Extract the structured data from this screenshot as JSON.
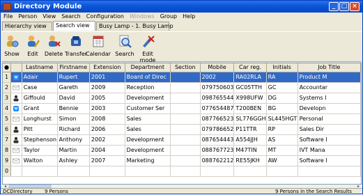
{
  "window": {
    "title": "Directory Module"
  },
  "menu": [
    {
      "label": "File",
      "disabled": false
    },
    {
      "label": "Person",
      "disabled": false
    },
    {
      "label": "View",
      "disabled": false
    },
    {
      "label": "Search",
      "disabled": false
    },
    {
      "label": "Configuration",
      "disabled": false
    },
    {
      "label": "Windows",
      "disabled": true
    },
    {
      "label": "Group",
      "disabled": false
    },
    {
      "label": "Help",
      "disabled": false
    }
  ],
  "tabs": [
    "Hierarchy view",
    "Search view",
    "Busy Lamp - 1. Busy Lamp"
  ],
  "toolbar": {
    "show": "Show",
    "edit": "Edit",
    "delete": "Delete",
    "transfer": "Transfer",
    "calendar": "Calendar",
    "search": "Search",
    "edit_mode": "Edit mode"
  },
  "columns": [
    "Lastname",
    "Firstname",
    "Extension",
    "Department",
    "Section",
    "Mobile",
    "Car reg.",
    "Initials",
    "Job Title"
  ],
  "rows": [
    {
      "n": "1",
      "icon": "phone-person-icon",
      "lastname": "Adair",
      "firstname": "Rupert",
      "extension": "2001",
      "department": "Board of Direc",
      "section": "",
      "mobile": "2002",
      "carreg": "RA02RLA",
      "initials": "RA",
      "jobtitle": "Product M"
    },
    {
      "n": "2",
      "icon": "envelope-icon",
      "lastname": "Case",
      "firstname": "Gareth",
      "extension": "2009",
      "department": "Reception",
      "section": "",
      "mobile": "079750603",
      "carreg": "GC05TTH",
      "initials": "GC",
      "jobtitle": "Accountar"
    },
    {
      "n": "3",
      "icon": "person-busy-icon",
      "lastname": "Giffould",
      "firstname": "David",
      "extension": "2005",
      "department": "Development",
      "section": "",
      "mobile": "098765544",
      "carreg": "X998UFW",
      "initials": "DG",
      "jobtitle": "Systems I"
    },
    {
      "n": "4",
      "icon": "phone-person-icon",
      "lastname": "Grant",
      "firstname": "Bennie",
      "extension": "2003",
      "department": "Customer Ser",
      "section": "",
      "mobile": "077654487",
      "carreg": "T200BEN",
      "initials": "BG",
      "jobtitle": "Developn"
    },
    {
      "n": "5",
      "icon": "envelope-icon",
      "lastname": "Longhurst",
      "firstname": "Simon",
      "extension": "2008",
      "department": "Sales",
      "section": "",
      "mobile": "087766523",
      "carreg": "SL776GGH",
      "initials": "SL445HGT",
      "jobtitle": "Personal"
    },
    {
      "n": "6",
      "icon": "person-busy-icon",
      "lastname": "Pitt",
      "firstname": "Richard",
      "extension": "2006",
      "department": "Sales",
      "section": "",
      "mobile": "079786652",
      "carreg": "P11TTR",
      "initials": "RP",
      "jobtitle": "Sales Dir"
    },
    {
      "n": "7",
      "icon": "person-busy-icon",
      "lastname": "Stephenson",
      "firstname": "Anthony",
      "extension": "2002",
      "department": "Development",
      "section": "",
      "mobile": "087654443",
      "carreg": "A554JJH",
      "initials": "AS",
      "jobtitle": "Software I"
    },
    {
      "n": "8",
      "icon": "envelope-icon",
      "lastname": "Taylor",
      "firstname": "Martin",
      "extension": "2004",
      "department": "Development",
      "section": "",
      "mobile": "088767723",
      "carreg": "M47TIN",
      "initials": "MT",
      "jobtitle": "IVT Mana"
    },
    {
      "n": "9",
      "icon": "envelope-icon",
      "lastname": "Walton",
      "firstname": "Ashley",
      "extension": "2007",
      "department": "Marketing",
      "section": "",
      "mobile": "088762212",
      "carreg": "RE55JKH",
      "initials": "AW",
      "jobtitle": "Software I"
    },
    {
      "n": "0",
      "icon": "",
      "lastname": "",
      "firstname": "",
      "extension": "",
      "department": "",
      "section": "",
      "mobile": "",
      "carreg": "",
      "initials": "",
      "jobtitle": ""
    }
  ],
  "status": {
    "source": "DCDirectory",
    "count": "9 Persons",
    "results": "9 Persons in the Search Results"
  },
  "colors": {
    "titlebar": "#0a55d8",
    "selection": "#316ac5",
    "chrome": "#ece9d8"
  }
}
